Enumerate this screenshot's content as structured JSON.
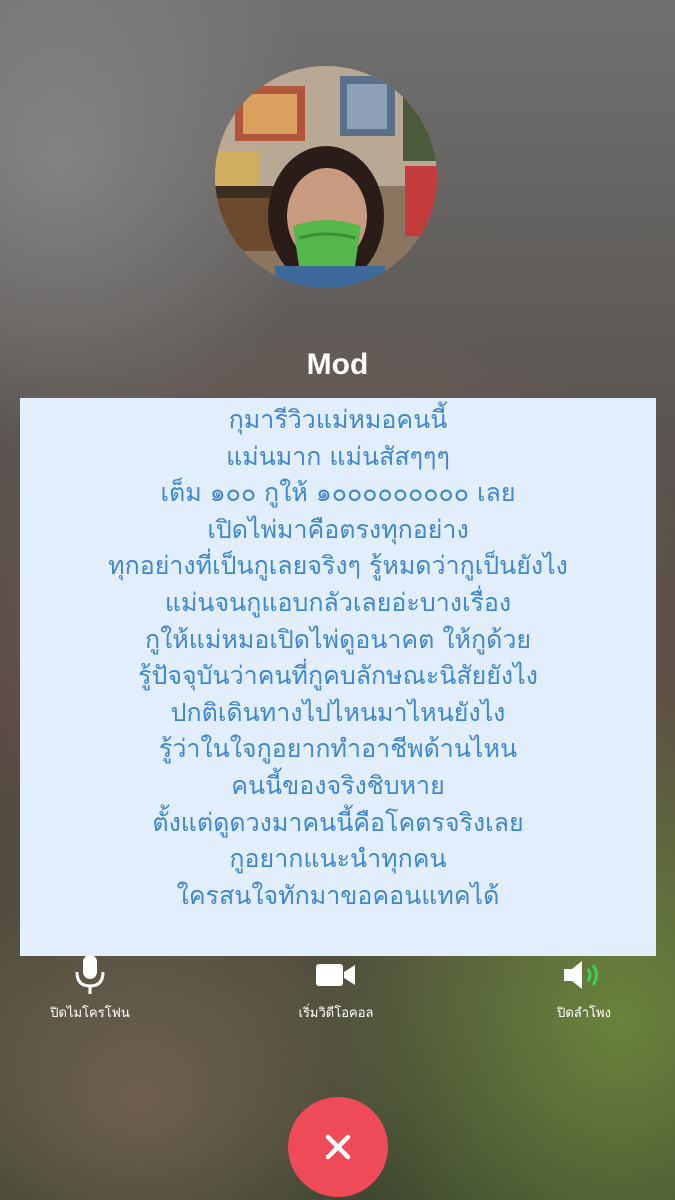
{
  "caller": {
    "name": "Mod",
    "avatar_icon": "profile-photo"
  },
  "message": {
    "lines": [
      "กุมารีวิวแม่หมอคนนี้",
      "แม่นมาก แม่นสัสๆๆๆ",
      "เต็ม ๑๐๐ กูให้ ๑๐๐๐๐๐๐๐๐๐ เลย",
      "เปิดไพ่มาคือตรงทุกอย่าง",
      "ทุกอย่างที่เป็นกูเลยจริงๆ รู้หมดว่ากูเป็นยังไง",
      "แม่นจนกูแอบกลัวเลยอ่ะบางเรื่อง",
      "กูให้แม่หมอเปิดไพ่ดูอนาคต ให้กูด้วย",
      "รู้ปัจจุบันว่าคนที่กูคบลักษณะนิสัยยังไง",
      "ปกติเดินทางไปไหนมาไหนยังไง",
      "รู้ว่าในใจกูอยากทำอาชีพด้านไหน",
      "คนนี้ของจริงชิบหาย",
      "ตั้งแต่ดูดวงมาคนนี้คือโคตรจริงเลย",
      "กูอยากแนะนำทุกคน",
      "ใครสนใจทักมาขอคอนแทคได้"
    ],
    "text_color": "#3f87d0",
    "background_color": "#e3eefc"
  },
  "controls": {
    "mute": {
      "label": "ปิดไมโครโฟน",
      "icon": "microphone-icon"
    },
    "video": {
      "label": "เริ่มวิดีโอคอล",
      "icon": "video-camera-icon"
    },
    "speaker": {
      "label": "ปิดลำโพง",
      "icon": "speaker-icon",
      "active_color": "#39d353"
    }
  },
  "end_call": {
    "icon": "close-icon",
    "color": "#ef4a57"
  }
}
